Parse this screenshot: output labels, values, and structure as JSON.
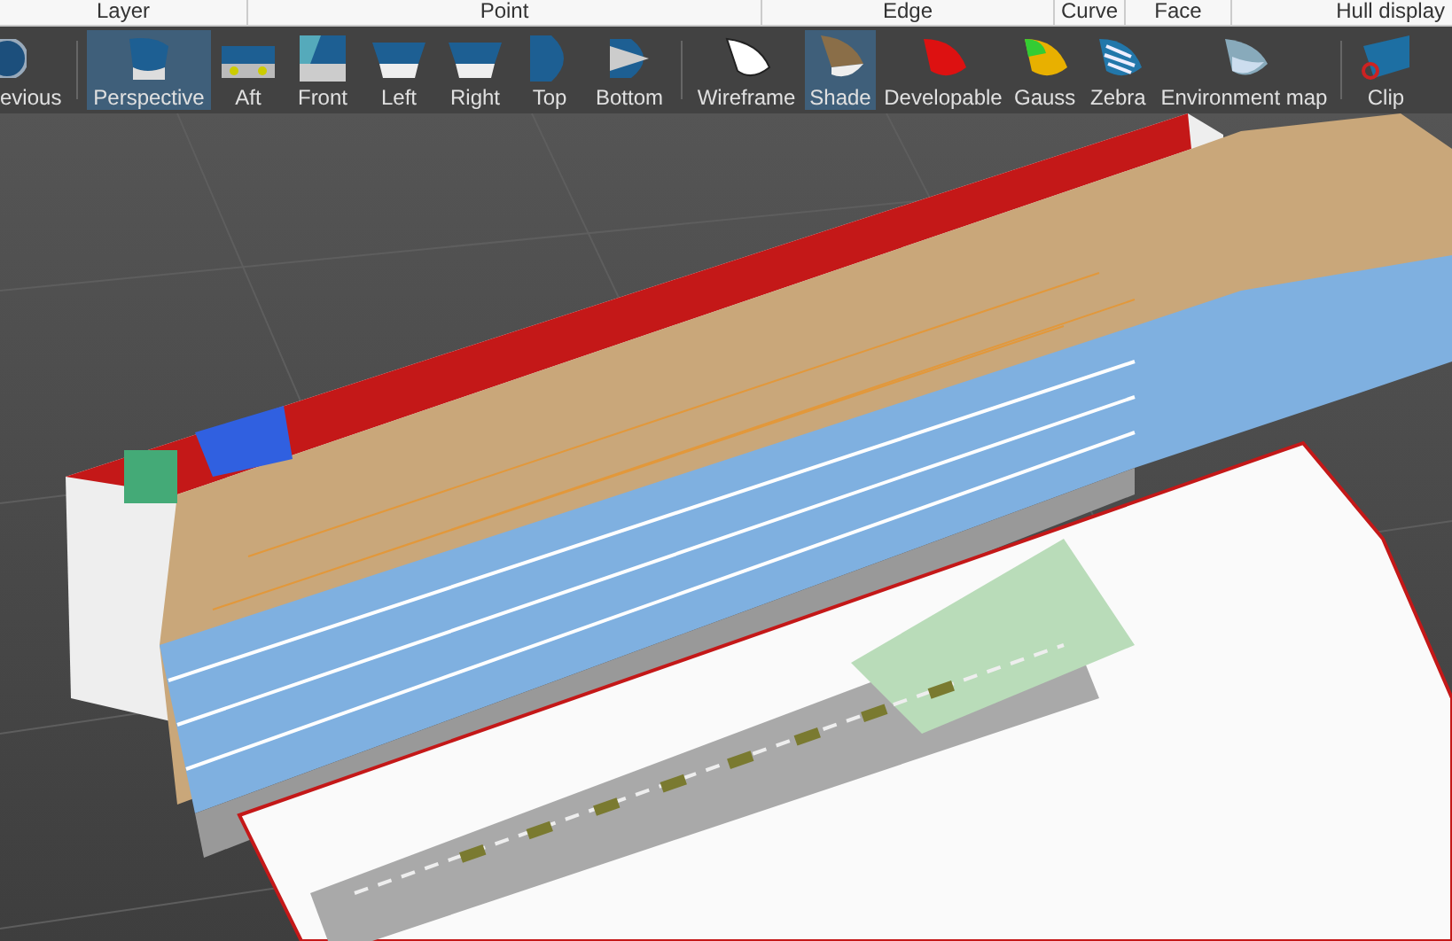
{
  "ribbon_groups": [
    {
      "label": "Layer"
    },
    {
      "label": "Point"
    },
    {
      "label": "Edge"
    },
    {
      "label": "Curve"
    },
    {
      "label": "Face"
    },
    {
      "label": "Hull display"
    }
  ],
  "toolbar": {
    "buttons": [
      {
        "label": "evious",
        "selected": false
      },
      {
        "label": "Perspective",
        "selected": true
      },
      {
        "label": "Aft",
        "selected": false
      },
      {
        "label": "Front",
        "selected": false
      },
      {
        "label": "Left",
        "selected": false
      },
      {
        "label": "Right",
        "selected": false
      },
      {
        "label": "Top",
        "selected": false
      },
      {
        "label": "Bottom",
        "selected": false
      },
      {
        "label": "Wireframe",
        "selected": false
      },
      {
        "label": "Shade",
        "selected": true
      },
      {
        "label": "Developable",
        "selected": false
      },
      {
        "label": "Gauss",
        "selected": false
      },
      {
        "label": "Zebra",
        "selected": false
      },
      {
        "label": "Environment map",
        "selected": false
      },
      {
        "label": "Clip",
        "selected": false
      }
    ]
  }
}
